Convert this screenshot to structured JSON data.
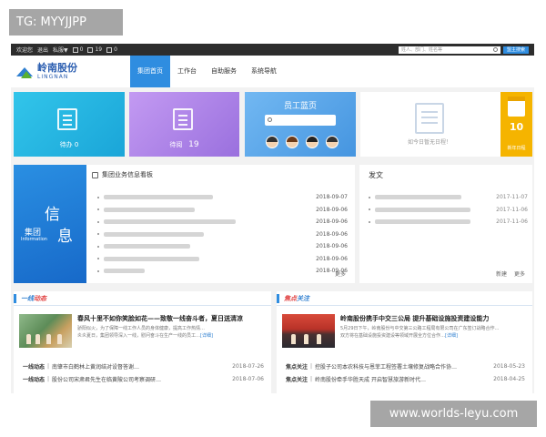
{
  "watermark_top": "TG: MYYJJPP",
  "watermark_bottom": "www.worlds-leyu.com",
  "topbar": {
    "items": [
      "欢迎您",
      "退出",
      "私服▼",
      "0",
      "19",
      "0"
    ],
    "search_placeholder": "姓人、部门、姓名等",
    "search_button": "盟主搜索"
  },
  "logo": {
    "cn": "岭南股份",
    "en": "LINGNAN"
  },
  "nav": [
    "集团首页",
    "工作台",
    "自助服务",
    "系统导航"
  ],
  "tiles": {
    "todo": "待办 0",
    "reading": "待阅",
    "reading_count": "19",
    "employee_title": "员工蓝页",
    "todo_empty": "如今日暂无日程！",
    "calendar_label": "新年日程",
    "calendar_day": "10"
  },
  "board": {
    "banner_char1": "信",
    "banner_char2": "息",
    "banner_title": "集团",
    "banner_en": "Information",
    "title": "集团业务信息看板",
    "dates": [
      "2018-09-07",
      "2018-09-06",
      "2018-09-06",
      "2018-09-06",
      "2018-09-06",
      "2018-09-06",
      "2018-09-06"
    ],
    "more": "更多"
  },
  "fawen": {
    "title": "发文",
    "dates": [
      "2017-11-07",
      "2017-11-06",
      "2017-11-06"
    ],
    "new": "新建",
    "more": "更多"
  },
  "news_left": {
    "title_a": "一线",
    "title_b": "动态",
    "headline": "春风十里不如你笑脸如花——致敬一线奋斗者，夏日送清凉",
    "summary_1": "骄阳似火，为了保障一线工作人员的身体健康，提高工作热情…",
    "summary_2": "炎炎夏日，集团领导深入一线，慰问奋斗在生产一线的员工…",
    "summary_link": "[详细]",
    "rows": [
      {
        "cat": "一线动态",
        "text": "南肇市白鹤林上黄润结对设督答谢…",
        "date": "2018-07-26"
      },
      {
        "cat": "一线动态",
        "text": "股份公司宋肃君先生在临黄陂公司考察调研…",
        "date": "2018-07-06"
      }
    ]
  },
  "news_right": {
    "title_a": "焦点",
    "title_b": "关注",
    "headline": "岭南股份携手中交三公局 提升基础设施投资建设能力",
    "summary_1": "5月29日下午，岭南股份与中交第三公路工程局有限公司在广东签订战略合作…",
    "summary_2": "双方将在基础设施投资建设等领域开展全方位合作…",
    "summary_link": "[详细]",
    "rows": [
      {
        "cat": "焦点关注",
        "text": "控股子公司本农科技与恩菲工程签署土壤修复战略合作协…",
        "date": "2018-05-23"
      },
      {
        "cat": "焦点关注",
        "text": "岭南股份牵手华胜天成 开启智慧旅游新时代…",
        "date": "2018-04-25"
      }
    ]
  }
}
